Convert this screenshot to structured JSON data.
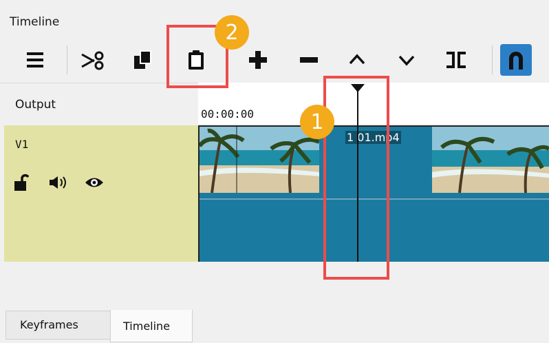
{
  "panel": {
    "title": "Timeline"
  },
  "toolbar": {
    "menu_icon": "hamburger-menu-icon",
    "cut_icon": "scissors-icon",
    "copy_icon": "copy-icon",
    "paste_icon": "clipboard-icon",
    "append_icon": "plus-icon",
    "remove_icon": "minus-icon",
    "lift_icon": "chevron-up-icon",
    "overwrite_icon": "chevron-down-icon",
    "split_icon": "split-icon",
    "snap_icon": "magnet-icon",
    "accent": "#2c7fc7"
  },
  "timeline": {
    "output_label": "Output",
    "ruler_time": "00:00:00",
    "track": {
      "name": "V1",
      "lock_icon": "unlock-icon",
      "audio_icon": "speaker-icon",
      "visible_icon": "eye-icon"
    },
    "clip": {
      "name": "1 01.mp4",
      "color": "#1b7aa0"
    }
  },
  "tabs": [
    {
      "label": "Keyframes"
    },
    {
      "label": "Timeline"
    }
  ],
  "annotations": [
    {
      "number": "1",
      "color": "#f3aa1b"
    },
    {
      "number": "2",
      "color": "#f3aa1b"
    }
  ]
}
